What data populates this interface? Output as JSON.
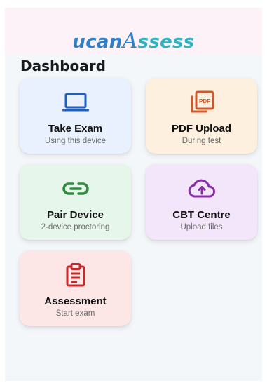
{
  "header": {
    "logo_part1": "ucan",
    "logo_part2": "A",
    "logo_part3": "ssess"
  },
  "page_title": "Dashboard",
  "cards": [
    {
      "title": "Take Exam",
      "subtitle": "Using this device",
      "icon": "laptop-icon",
      "color": "#1f5fbf"
    },
    {
      "title": "PDF Upload",
      "subtitle": "During test",
      "icon": "pdf-file-icon",
      "color": "#d2572a"
    },
    {
      "title": "Pair Device",
      "subtitle": "2-device proctoring",
      "icon": "link-icon",
      "color": "#2e8b3d"
    },
    {
      "title": "CBT Centre",
      "subtitle": "Upload files",
      "icon": "cloud-upload-icon",
      "color": "#8a2ea6"
    },
    {
      "title": "Assessment",
      "subtitle": "Start exam",
      "icon": "clipboard-icon",
      "color": "#c62828"
    }
  ]
}
